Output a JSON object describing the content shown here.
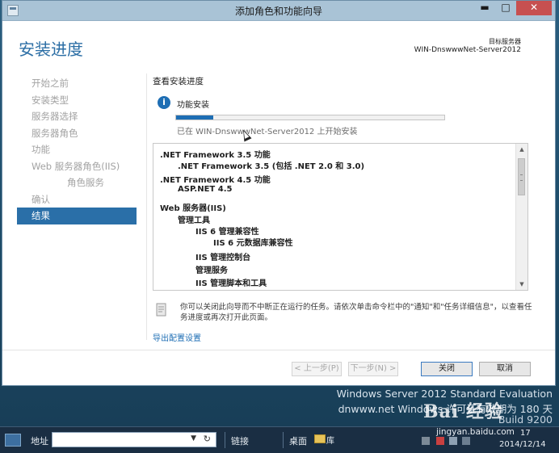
{
  "window": {
    "title": "添加角色和功能向导",
    "minimize": "▬",
    "maximize": "□",
    "close": "✕"
  },
  "header": {
    "page_title": "安装进度",
    "dest_label": "目标服务器",
    "dest_value": "WIN-DnswwwNet-Server2012"
  },
  "nav": {
    "items": [
      {
        "label": "开始之前",
        "active": false,
        "sub": false
      },
      {
        "label": "安装类型",
        "active": false,
        "sub": false
      },
      {
        "label": "服务器选择",
        "active": false,
        "sub": false
      },
      {
        "label": "服务器角色",
        "active": false,
        "sub": false
      },
      {
        "label": "功能",
        "active": false,
        "sub": false
      },
      {
        "label": "Web 服务器角色(IIS)",
        "active": false,
        "sub": false
      },
      {
        "label": "角色服务",
        "active": false,
        "sub": true
      },
      {
        "label": "确认",
        "active": false,
        "sub": false
      },
      {
        "label": "结果",
        "active": true,
        "sub": false
      }
    ]
  },
  "main": {
    "section_heading": "查看安装进度",
    "info_icon": "i",
    "feature_install": "功能安装",
    "progress_fraction": 0.14,
    "status_text": "已在 WIN-DnswwwNet-Server2012 上开始安装",
    "results": [
      {
        "text": ".NET Framework 3.5 功能",
        "level": 0
      },
      {
        "text": ".NET Framework 3.5 (包括 .NET 2.0 和 3.0)",
        "level": 1
      },
      {
        "text": ".NET Framework 4.5 功能",
        "level": 0
      },
      {
        "text": "ASP.NET 4.5",
        "level": 1
      },
      {
        "text": "Web 服务器(IIS)",
        "level": 0
      },
      {
        "text": "管理工具",
        "level": 1
      },
      {
        "text": "IIS 6 管理兼容性",
        "level": 2
      },
      {
        "text": "IIS 6 元数据库兼容性",
        "level": 3
      },
      {
        "text": "IIS 管理控制台",
        "level": 2
      },
      {
        "text": "管理服务",
        "level": 2
      },
      {
        "text": "IIS 管理脚本和工具",
        "level": 2
      }
    ],
    "note": "你可以关闭此向导而不中断正在运行的任务。请依次单击命令栏中的\"通知\"和\"任务详细信息\"，以查看任务进度或再次打开此页面。",
    "export_link": "导出配置设置"
  },
  "buttons": {
    "prev": "< 上一步(P)",
    "next": "下一步(N) >",
    "close": "关闭",
    "cancel": "取消"
  },
  "desktop": {
    "watermark_line1": "Windows Server 2012 Standard Evaluation",
    "watermark_line2": "dnwww.net Windows 许可证有效期为 180 天",
    "watermark_line3": "Build 9200",
    "baidu_logo": "Bai 经验"
  },
  "taskbar": {
    "address_label": "地址",
    "address_value": "",
    "links_label": "链接",
    "desktop_label": "桌面",
    "library_label": "库",
    "jingyan": "jingyan.baidu.com",
    "time": "17",
    "date": "2014/12/14"
  },
  "icons": {
    "app_icon": "server-manager-icon",
    "info": "info-icon",
    "note": "note-icon",
    "dropdown": "chevron-down-icon",
    "refresh": "refresh-icon",
    "folder": "folder-icon"
  },
  "colors": {
    "accent": "#2a6fa8",
    "progress": "#1e6eb4",
    "close_button": "#c75050"
  }
}
